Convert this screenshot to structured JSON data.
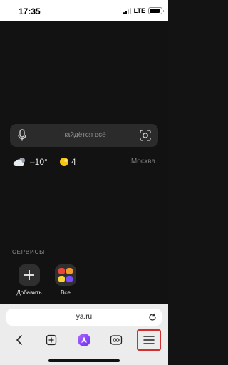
{
  "status_bar": {
    "time": "17:35",
    "network": "LTE",
    "battery_level": 0.9
  },
  "search": {
    "placeholder": "найдётся всё",
    "left_icon": "microphone-icon",
    "right_icon": "camera-lens-icon"
  },
  "widgets": {
    "weather_icon": "cloudy-icon",
    "temperature": "–10°",
    "traffic_icon": "traffic-light-icon",
    "traffic_score": "4",
    "city": "Москва"
  },
  "services": {
    "title": "СЕРВИСЫ",
    "items": [
      {
        "label": "Добавить",
        "icon": "plus-icon"
      },
      {
        "label": "Все",
        "icon": "apps-grid-icon"
      }
    ]
  },
  "url_bar": {
    "url": "ya.ru",
    "icon": "reload-icon"
  },
  "toolbar": {
    "items": [
      {
        "name": "back",
        "icon": "chevron-left-icon"
      },
      {
        "name": "new-tab",
        "icon": "plus-square-icon"
      },
      {
        "name": "alice",
        "icon": "alice-icon"
      },
      {
        "name": "tabs",
        "icon": "tabs-icon"
      },
      {
        "name": "menu",
        "icon": "hamburger-menu-icon",
        "highlighted": true
      }
    ]
  },
  "colors": {
    "page_background": "#121212",
    "search_background": "#2b2b2b",
    "alice_accent": "#8a3ffc",
    "highlight": "#d32f2f"
  }
}
